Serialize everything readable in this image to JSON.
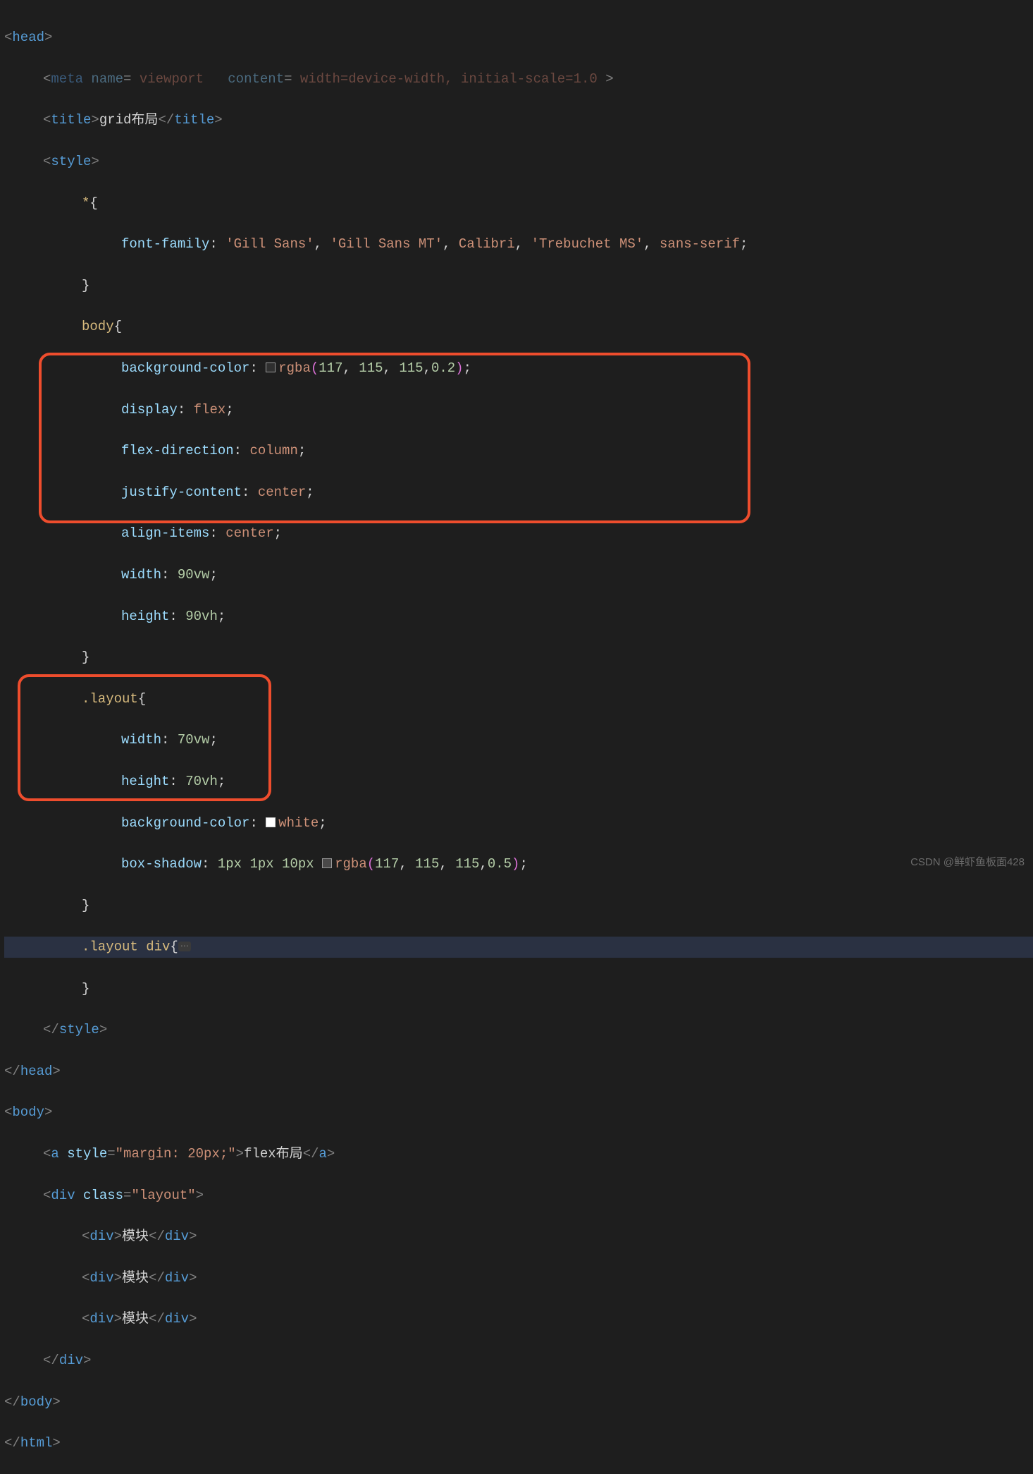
{
  "watermark": "CSDN @鲜虾鱼板面428",
  "code": {
    "line1_cut": "    meta name= viewport   content= width=device-width, initial-scale=1.0",
    "tag_head": "head",
    "tag_meta": "meta",
    "tag_title": "title",
    "tag_style": "style",
    "tag_body": "body",
    "tag_html": "html",
    "tag_a": "a",
    "tag_div": "div",
    "title_text": "grid布局",
    "sel_star": "*",
    "sel_body": "body",
    "sel_layout": ".layout",
    "sel_layout_div": ".layout div",
    "prop_font_family": "font-family",
    "val_font_family_1": "'Gill Sans'",
    "val_font_family_2": "'Gill Sans MT'",
    "val_font_family_3": "Calibri",
    "val_font_family_4": "'Trebuchet MS'",
    "val_font_family_5": "sans-serif",
    "prop_bg": "background-color",
    "prop_display": "display",
    "val_flex": "flex",
    "prop_flex_dir": "flex-direction",
    "val_column": "column",
    "prop_justify": "justify-content",
    "val_center": "center",
    "prop_align": "align-items",
    "prop_width": "width",
    "val_90vw": "90vw",
    "prop_height": "height",
    "val_90vh": "90vh",
    "val_70vw": "70vw",
    "val_70vh": "70vh",
    "val_white": "white",
    "prop_box_shadow": "box-shadow",
    "num_1px": "1px",
    "num_10px": "10px",
    "rgba_func": "rgba",
    "rgba_117": "117",
    "rgba_115": "115",
    "rgba_02": "0.2",
    "rgba_05": "0.5",
    "attr_style": "style",
    "attr_class": "class",
    "attr_name": "name",
    "attr_content": "content",
    "val_margin20": "\"margin: 20px;\"",
    "val_layout": "\"layout\"",
    "a_text": "flex布局",
    "div_text": "模块"
  }
}
